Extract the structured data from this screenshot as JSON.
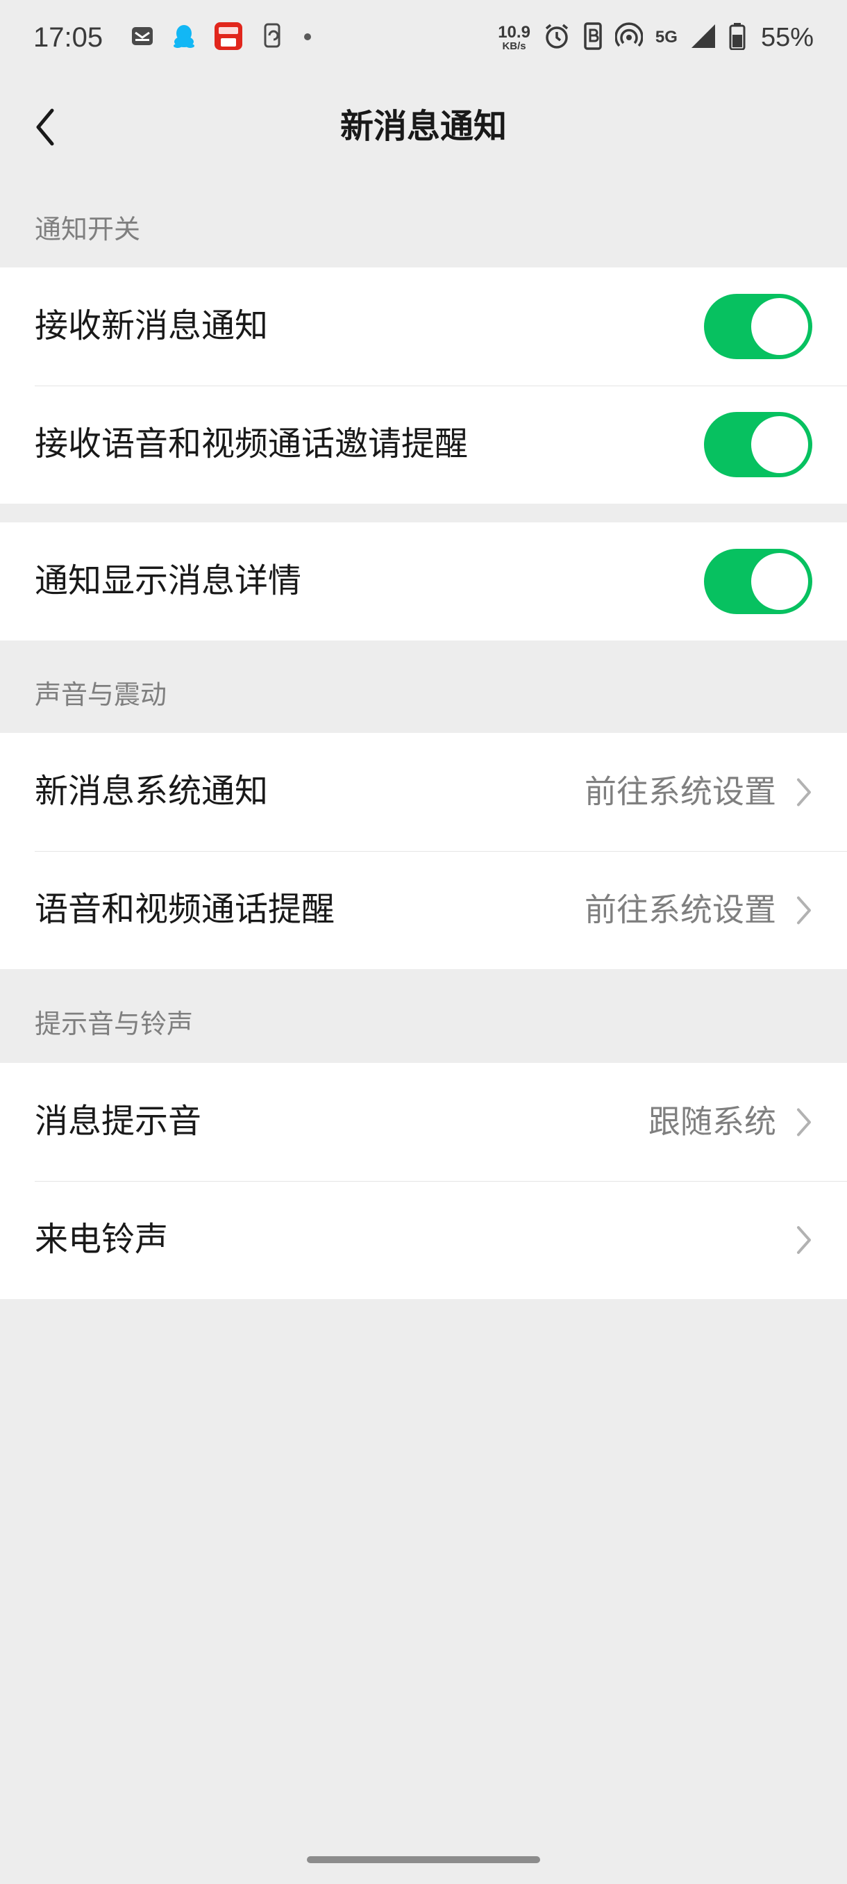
{
  "status_bar": {
    "time": "17:05",
    "left_icons": [
      "mail-icon",
      "qq-penguin-icon",
      "unionpay-app-icon",
      "phone-sync-icon",
      "dot-icon"
    ],
    "net_speed_value": "10.9",
    "net_speed_unit": "KB/s",
    "network_label": "5G",
    "battery_percent": "55%"
  },
  "nav": {
    "title": "新消息通知"
  },
  "sections": {
    "notification_switch": {
      "header": "通知开关",
      "items": [
        {
          "label": "接收新消息通知",
          "toggle": true
        },
        {
          "label": "接收语音和视频通话邀请提醒",
          "toggle": true
        }
      ]
    },
    "details": {
      "items": [
        {
          "label": "通知显示消息详情",
          "toggle": true
        }
      ]
    },
    "sound_vibration": {
      "header": "声音与震动",
      "items": [
        {
          "label": "新消息系统通知",
          "value": "前往系统设置"
        },
        {
          "label": "语音和视频通话提醒",
          "value": "前往系统设置"
        }
      ]
    },
    "ringtones": {
      "header": "提示音与铃声",
      "items": [
        {
          "label": "消息提示音",
          "value": "跟随系统"
        },
        {
          "label": "来电铃声",
          "value": ""
        }
      ]
    }
  },
  "colors": {
    "toggle_on": "#07c160",
    "page_background": "#ededed",
    "secondary_text": "#7f7f7f"
  }
}
